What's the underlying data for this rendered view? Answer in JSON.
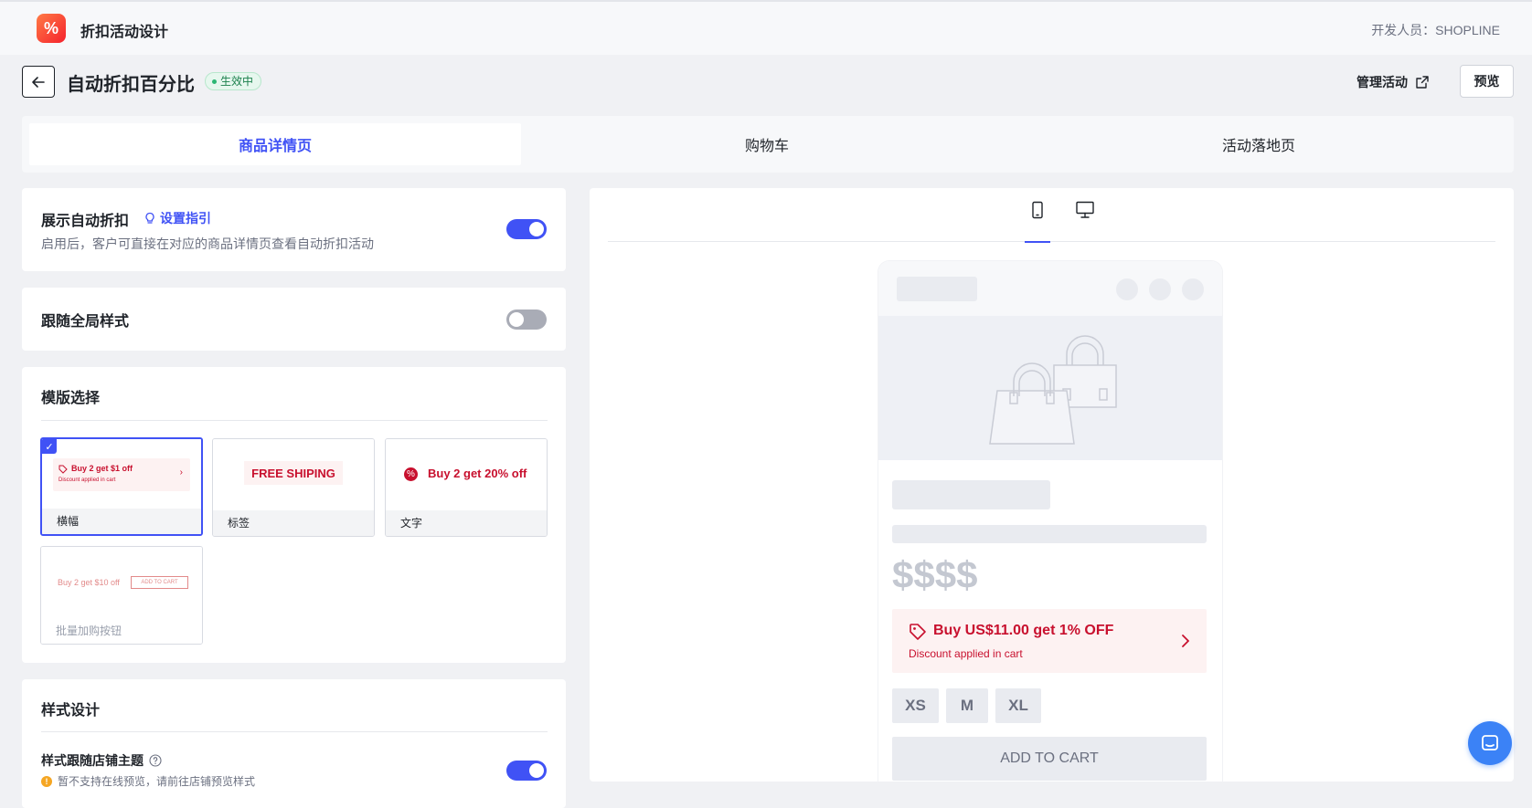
{
  "app": {
    "title": "折扣活动设计",
    "developer_label": "开发人员：SHOPLINE"
  },
  "header": {
    "title": "自动折扣百分比",
    "status": "生效中",
    "manage_label": "管理活动",
    "preview_label": "预览"
  },
  "tabs": [
    {
      "label": "商品详情页",
      "active": true
    },
    {
      "label": "购物车",
      "active": false
    },
    {
      "label": "活动落地页",
      "active": false
    }
  ],
  "show_discount": {
    "title": "展示自动折扣",
    "guide_label": "设置指引",
    "desc": "启用后，客户可直接在对应的商品详情页查看自动折扣活动",
    "enabled": true
  },
  "global_style": {
    "title": "跟随全局样式",
    "enabled": false
  },
  "template": {
    "title": "模版选择",
    "options": [
      {
        "label": "横幅",
        "preview_title": "Buy 2 get $1 off",
        "preview_sub": "Discount applied in cart",
        "selected": true
      },
      {
        "label": "标签",
        "preview_title": "FREE SHIPING",
        "selected": false
      },
      {
        "label": "文字",
        "preview_title": "Buy 2 get 20% off",
        "selected": false
      },
      {
        "label": "批量加购按钮",
        "preview_title": "Buy 2 get $10 off",
        "preview_button": "ADD TO CART",
        "disabled": true
      }
    ]
  },
  "style_design": {
    "title": "样式设计",
    "follow_theme_label": "样式跟随店铺主题",
    "warning": "暂不支持在线预览，请前往店铺预览样式",
    "enabled": true
  },
  "preview": {
    "price_placeholder": "$$$$",
    "banner_title": "Buy US$11.00 get 1% OFF",
    "banner_sub": "Discount applied in cart",
    "sizes": [
      "XS",
      "M",
      "XL"
    ],
    "add_to_cart": "ADD TO CART"
  },
  "colors": {
    "accent": "#4052f5",
    "discount_red": "#c8102e",
    "success": "#2bb673"
  }
}
